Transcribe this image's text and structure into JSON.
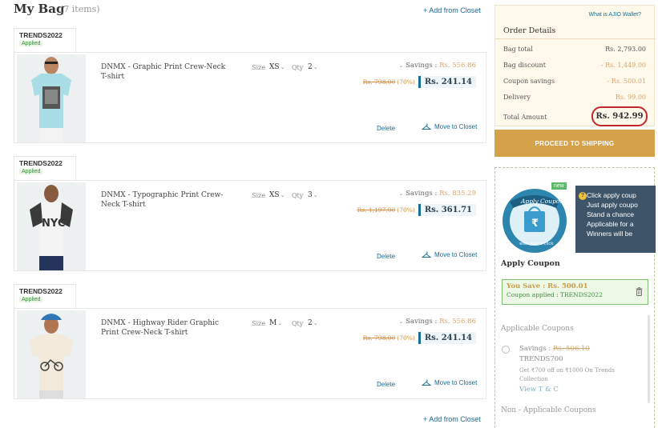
{
  "header": {
    "title": "My Bag",
    "count": "(7 items)",
    "add_closet": "+ Add from Closet"
  },
  "items": [
    {
      "coupon_code": "TRENDS2022",
      "coupon_status": "Applied",
      "name": "DNMX - Graphic Print Crew-Neck T-shirt",
      "size_label": "Size",
      "size": "XS",
      "qty_label": "Qty",
      "qty": "2",
      "savings_label": "Savings :",
      "savings_value": "Rs. 556.86",
      "mrp": "Rs. 798.00",
      "discount": "(70%)",
      "price": "Rs. 241.14",
      "delete_label": "Delete",
      "move_label": "Move to Closet"
    },
    {
      "coupon_code": "TRENDS2022",
      "coupon_status": "Applied",
      "name": "DNMX - Typographic Print Crew-Neck T-shirt",
      "size_label": "Size",
      "size": "XS",
      "qty_label": "Qty",
      "qty": "3",
      "savings_label": "Savings :",
      "savings_value": "Rs. 835.29",
      "mrp": "Rs. 1,197.00",
      "discount": "(70%)",
      "price": "Rs. 361.71",
      "delete_label": "Delete",
      "move_label": "Move to Closet"
    },
    {
      "coupon_code": "TRENDS2022",
      "coupon_status": "Applied",
      "name": "DNMX - Highway Rider Graphic Print Crew-Neck T-shirt",
      "size_label": "Size",
      "size": "M",
      "qty_label": "Qty",
      "qty": "2",
      "savings_label": "Savings :",
      "savings_value": "Rs. 556.86",
      "mrp": "Rs. 798.00",
      "discount": "(70%)",
      "price": "Rs. 241.14",
      "delete_label": "Delete",
      "move_label": "Move to Closet"
    }
  ],
  "order": {
    "wallet_link": "What is AJIO Wallet?",
    "title": "Order Details",
    "rows": [
      {
        "label": "Bag total",
        "value": "Rs. 2,793.00"
      },
      {
        "label": "Bag discount",
        "value": "- Rs. 1,449.00"
      },
      {
        "label": "Coupon savings",
        "value": "- Rs. 500.01"
      },
      {
        "label": "Delivery",
        "value": "Rs. 99.00"
      }
    ],
    "total_label": "Total Amount",
    "total_value": "Rs. 942.99",
    "proceed_label": "PROCEED TO SHIPPING"
  },
  "coupon": {
    "badge": "new",
    "art_label": "Apply Coupon",
    "art_caption": "with just a click",
    "tooltip_lines": [
      "Click apply coup",
      "Just apply coupo",
      "Stand a chance",
      "Applicable for a",
      "Winners will be"
    ],
    "title": "Apply Coupon",
    "you_save": "You Save : Rs. 500.01",
    "coupon_applied": "Coupon applied : TRENDS2022",
    "applicable_heading": "Applicable Coupons",
    "applicable": [
      {
        "savings_label": "Savings :",
        "savings_value": "Rs. 506.10",
        "code": "TRENDS700",
        "description": "Get ₹700 off on ₹1000 On Trends Collection",
        "tc": "View T & C"
      }
    ],
    "non_applicable_heading": "Non - Applicable Coupons"
  },
  "colors": {
    "accent_blue": "#176d93",
    "proceed_gold": "#d5a249",
    "highlight_red": "#c3262d",
    "applied_green": "#3f8c3f"
  }
}
